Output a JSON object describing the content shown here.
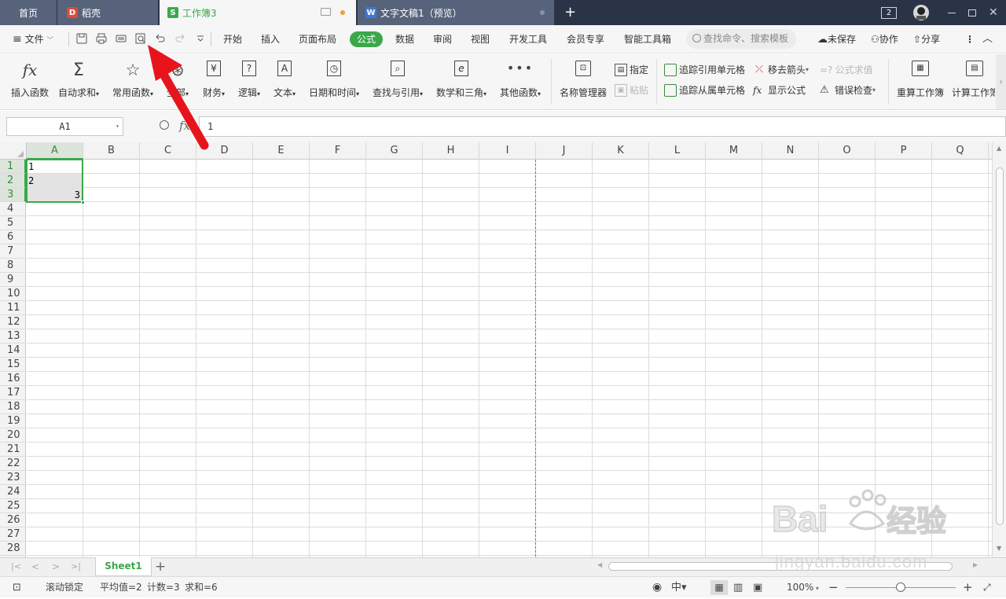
{
  "tabs": {
    "home": "首页",
    "daoke": "稻壳",
    "workbook": "工作簿3",
    "document": "文字文稿1（预览）",
    "window_count": "2"
  },
  "menu": {
    "file": "文件",
    "items": [
      "开始",
      "插入",
      "页面布局",
      "公式",
      "数据",
      "审阅",
      "视图",
      "开发工具",
      "会员专享",
      "智能工具箱"
    ],
    "active": "公式",
    "search_placeholder": "查找命令、搜索模板",
    "unsaved": "未保存",
    "collaborate": "协作",
    "share": "分享"
  },
  "ribbon": {
    "insert_function": "插入函数",
    "autosum": "自动求和",
    "common_functions": "常用函数",
    "all": "全部",
    "financial": "财务",
    "logical": "逻辑",
    "text": "文本",
    "datetime": "日期和时间",
    "lookup": "查找与引用",
    "math_trig": "数学和三角",
    "other_functions": "其他函数",
    "name_manager": "名称管理器",
    "define": "指定",
    "paste": "粘贴",
    "trace_precedents": "追踪引用单元格",
    "trace_dependents": "追踪从属单元格",
    "remove_arrows": "移去箭头",
    "show_formulas": "显示公式",
    "evaluate_formula": "公式求值",
    "error_check": "错误检查",
    "recalc_workbook": "重算工作簿",
    "calc_workbook": "计算工作簿"
  },
  "formula_bar": {
    "name_box": "A1",
    "fx": "fx",
    "content": "1"
  },
  "grid": {
    "columns": [
      "A",
      "B",
      "C",
      "D",
      "E",
      "F",
      "G",
      "H",
      "I",
      "J",
      "K",
      "L",
      "M",
      "N",
      "O",
      "P",
      "Q"
    ],
    "rows": [
      "1",
      "2",
      "3",
      "4",
      "5",
      "6",
      "7",
      "8",
      "9",
      "10",
      "11",
      "12",
      "13",
      "14",
      "15",
      "16",
      "17",
      "18",
      "19",
      "20",
      "21",
      "22",
      "23",
      "24",
      "25",
      "26",
      "27",
      "28"
    ],
    "selected_range": "A1:A3",
    "cells": {
      "A1": "1",
      "A2": "2",
      "A3": "3"
    }
  },
  "sheets": {
    "tabs": [
      "Sheet1"
    ],
    "active": "Sheet1"
  },
  "status": {
    "scroll_lock": "滚动锁定",
    "average": "平均值=2",
    "count": "计数=3",
    "sum": "求和=6",
    "zoom": "100%"
  },
  "watermark": {
    "brand": "Bai du 经验",
    "url": "jingyan.baidu.com"
  },
  "colors": {
    "accent_green": "#3aa84a",
    "titlebar": "#2b3447",
    "annotation_red": "#e8141c"
  }
}
